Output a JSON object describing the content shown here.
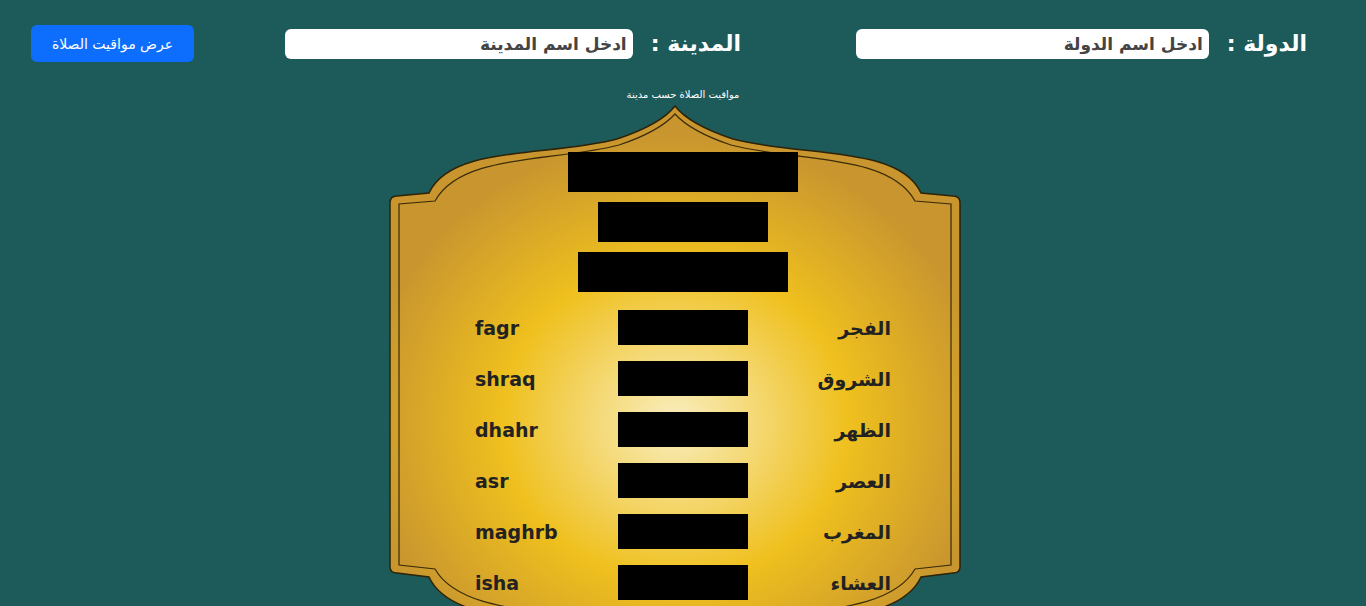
{
  "country": {
    "label": "الدولة :",
    "placeholder": "ادخل اسم الدولة"
  },
  "city": {
    "label": "المدينة :",
    "placeholder": "ادخل اسم المدينة"
  },
  "button": "عرض مواقيت الصلاة",
  "title": "مواقيت الصلاة حسب مدينة",
  "prayers": [
    {
      "arabic": "الفجر",
      "latin": "fagr"
    },
    {
      "arabic": "الشروق",
      "latin": "shraq"
    },
    {
      "arabic": "الظهر",
      "latin": "dhahr"
    },
    {
      "arabic": "العصر",
      "latin": "asr"
    },
    {
      "arabic": "المغرب",
      "latin": "maghrb"
    },
    {
      "arabic": "العشاء",
      "latin": "isha"
    }
  ]
}
